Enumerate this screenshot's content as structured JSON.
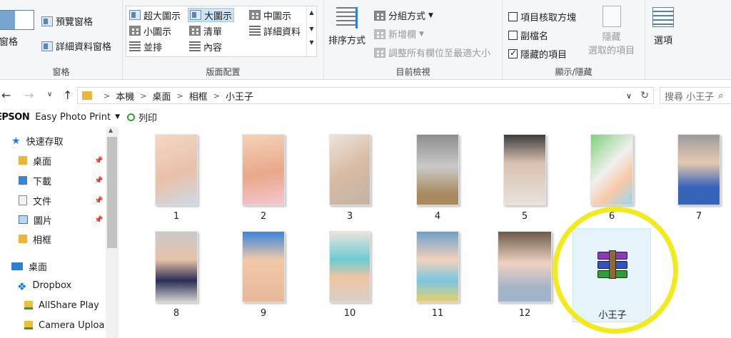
{
  "ribbon": {
    "panes": {
      "label": "窗格",
      "preview_pane": "預覽窗格",
      "details_pane": "詳細資料窗格",
      "nav_pane_partial": "覽窗格"
    },
    "layout": {
      "label": "版面配置",
      "items": [
        "超大圖示",
        "大圖示",
        "中圖示",
        "小圖示",
        "清單",
        "詳細資料",
        "並排",
        "內容"
      ],
      "selected": "大圖示"
    },
    "current_view": {
      "label": "目前檢視",
      "sort_by": "排序方式",
      "group_by": "分組方式",
      "add_columns": "新增欄",
      "size_columns": "調整所有欄位至最適大小"
    },
    "show_hide": {
      "label": "顯示/隱藏",
      "item_checkboxes": "項目核取方塊",
      "file_extensions": "副檔名",
      "hidden_items": "隱藏的項目",
      "hide_selected_1": "隱藏",
      "hide_selected_2": "選取的項目",
      "checks": {
        "item_checkboxes": false,
        "file_extensions": false,
        "hidden_items": true
      }
    },
    "options": {
      "label": "選項"
    }
  },
  "address": {
    "crumbs": [
      "本機",
      "桌面",
      "相框",
      "小王子"
    ],
    "search_placeholder": "搜尋 小王子"
  },
  "epson": {
    "logo": "EPSON",
    "app": "Easy Photo Print",
    "print": "列印"
  },
  "nav": {
    "items": [
      {
        "label": "快速存取",
        "icon": "star-icon"
      },
      {
        "label": "桌面",
        "icon": "folder-icon",
        "pinned": true
      },
      {
        "label": "下載",
        "icon": "download-folder-icon",
        "pinned": true
      },
      {
        "label": "文件",
        "icon": "documents-icon",
        "pinned": true
      },
      {
        "label": "圖片",
        "icon": "pictures-icon",
        "pinned": true
      },
      {
        "label": "相框",
        "icon": "folder-icon",
        "pinned": false
      },
      {
        "label": "桌面",
        "icon": "desktop-icon"
      },
      {
        "label": "Dropbox",
        "icon": "dropbox-icon"
      },
      {
        "label": "AllShare Play",
        "icon": "synced-folder-icon"
      },
      {
        "label": "Camera Uploa",
        "icon": "synced-folder-icon"
      }
    ]
  },
  "files": {
    "photos": [
      "1",
      "2",
      "3",
      "4",
      "5",
      "6",
      "7",
      "8",
      "9",
      "10",
      "11",
      "12"
    ],
    "archive": "小王子"
  },
  "colors": {
    "ribbon_bg": "#f5f6f7",
    "selection": "#cce4f7",
    "highlight_ring": "#f1ea1c",
    "folder": "#e8b73a"
  }
}
